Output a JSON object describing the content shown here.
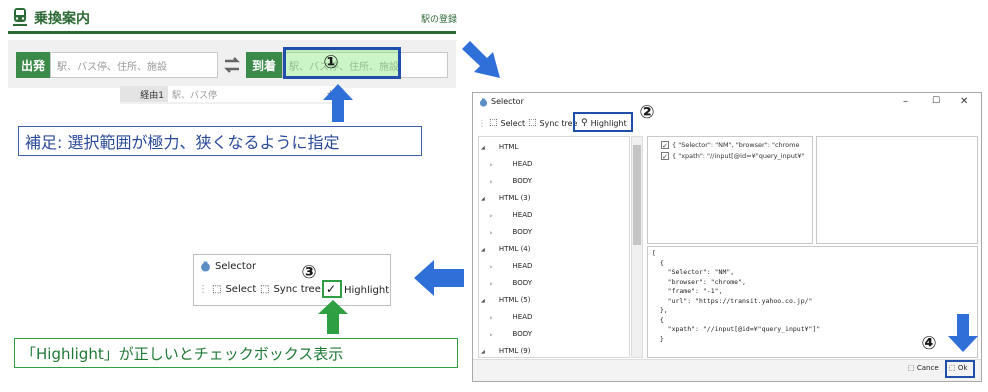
{
  "transit": {
    "title": "乗換案内",
    "register_link": "駅の登録",
    "from_label": "出発",
    "from_placeholder": "駅、バス停、住所、施設",
    "to_label": "到着",
    "to_placeholder": "駅、バス停、住所、施設",
    "via_label": "経由1",
    "via_placeholder": "駅、バス停",
    "via_add": "+"
  },
  "annotations": {
    "step1": "①",
    "step2": "②",
    "step3": "③",
    "step4": "④",
    "note_top": "補足: 選択範囲が極力、狭くなるように指定",
    "note_bottom": "「Highlight」が正しいとチェックボックス表示"
  },
  "selector_window": {
    "title": "Selector",
    "minimize": "–",
    "maximize": "☐",
    "close": "✕",
    "toolbar": {
      "select": "Select",
      "sync_tree": "Sync tree",
      "highlight": "Highlight"
    },
    "tree": [
      {
        "label": "HTML",
        "level": 0
      },
      {
        "label": "HEAD",
        "level": 1
      },
      {
        "label": "BODY",
        "level": 1
      },
      {
        "label": "HTML (3)",
        "level": 0
      },
      {
        "label": "HEAD",
        "level": 1
      },
      {
        "label": "BODY",
        "level": 1
      },
      {
        "label": "HTML (4)",
        "level": 0
      },
      {
        "label": "HEAD",
        "level": 1
      },
      {
        "label": "BODY",
        "level": 1
      },
      {
        "label": "HTML (5)",
        "level": 0
      },
      {
        "label": "HEAD",
        "level": 1
      },
      {
        "label": "BODY",
        "level": 1
      },
      {
        "label": "HTML (9)",
        "level": 0
      }
    ],
    "checks": [
      "{  \"Selector\": \"NM\",  \"browser\": \"chrome",
      "{  \"xpath\": \"//input[@id=¥\"query_input¥\""
    ],
    "json_lines": [
      "[",
      "  {",
      "    \"Selector\": \"NM\",",
      "    \"browser\": \"chrome\",",
      "    \"frame\": \"-1\",",
      "    \"url\": \"https://transit.yahoo.co.jp/\"",
      "  },",
      "  {",
      "    \"xpath\": \"//input[@id=¥\"query_input¥\"]\"",
      "  }"
    ],
    "cancel": "Cance",
    "ok": "Ok"
  },
  "mini_selector": {
    "title": "Selector",
    "select": "Select",
    "sync_tree": "Sync tree",
    "highlight": "Highlight",
    "check": "✓"
  },
  "colors": {
    "brand_green": "#2d6a35",
    "annotation_blue": "#1f4fa8",
    "arrow_blue": "#2f6fd8",
    "arrow_green": "#2ea043"
  }
}
